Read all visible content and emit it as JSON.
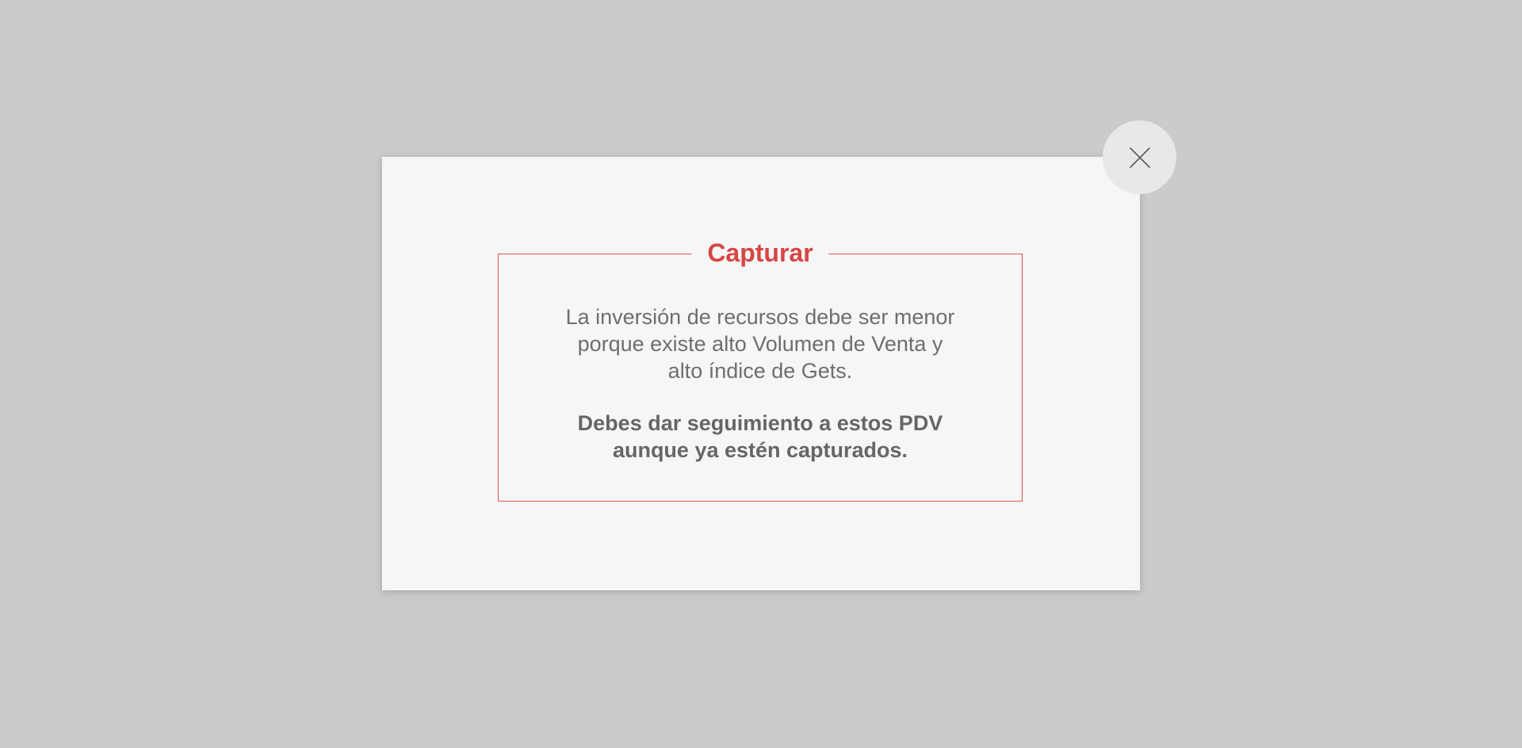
{
  "modal": {
    "title": "Capturar",
    "message_lines": [
      "La inversión de recursos debe ser menor",
      "porque existe alto Volumen de Venta y",
      "alto índice de Gets."
    ],
    "emphasis_lines": [
      "Debes dar seguimiento a estos PDV",
      "aunque ya estén capturados."
    ],
    "close_icon": "close-icon"
  },
  "colors": {
    "backdrop": "#cbcbcb",
    "modal_background": "#f6f6f6",
    "accent": "#d64545",
    "text": "#6e6e6e",
    "close_button_bg": "#e8e8e8"
  }
}
